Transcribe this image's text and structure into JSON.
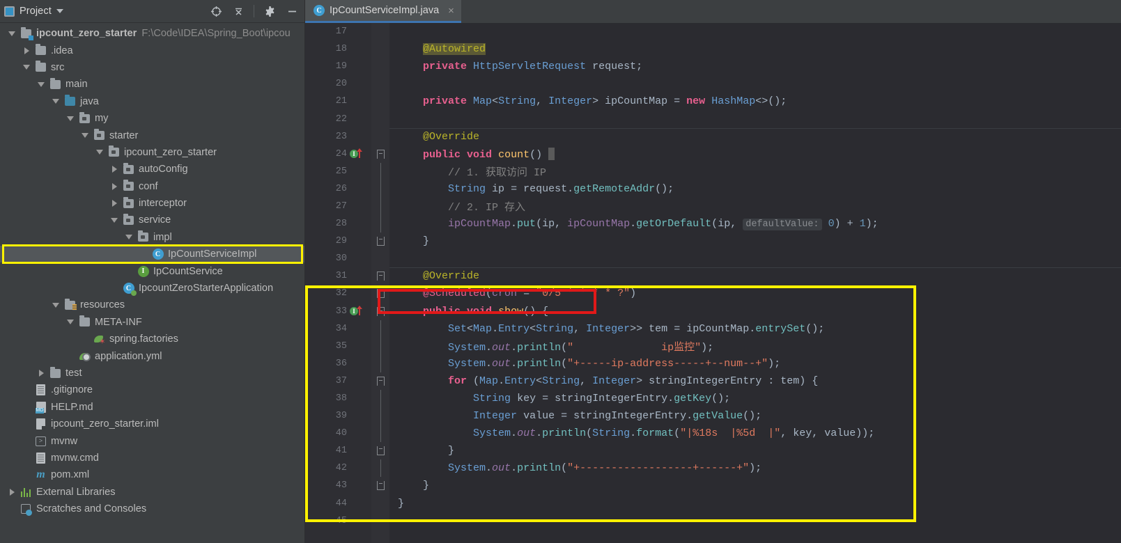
{
  "sidebar": {
    "header": {
      "title": "Project",
      "icons": [
        "project-icon",
        "chevron-down-icon",
        "locate-icon",
        "collapse-all-icon",
        "settings-gear-icon",
        "hide-icon"
      ]
    },
    "tree": [
      {
        "label": "ipcount_zero_starter",
        "path": "F:\\Code\\IDEA\\Spring_Boot\\ipcou",
        "depth": 0,
        "twisty": "down",
        "icon": "module-folder-icon",
        "bold": true
      },
      {
        "label": ".idea",
        "depth": 1,
        "twisty": "right",
        "icon": "folder-icon"
      },
      {
        "label": "src",
        "depth": 1,
        "twisty": "down",
        "icon": "folder-icon"
      },
      {
        "label": "main",
        "depth": 2,
        "twisty": "down",
        "icon": "folder-icon"
      },
      {
        "label": "java",
        "depth": 3,
        "twisty": "down",
        "icon": "source-folder-icon"
      },
      {
        "label": "my",
        "depth": 4,
        "twisty": "down",
        "icon": "package-icon"
      },
      {
        "label": "starter",
        "depth": 5,
        "twisty": "down",
        "icon": "package-icon"
      },
      {
        "label": "ipcount_zero_starter",
        "depth": 6,
        "twisty": "down",
        "icon": "package-icon"
      },
      {
        "label": "autoConfig",
        "depth": 7,
        "twisty": "right",
        "icon": "package-icon"
      },
      {
        "label": "conf",
        "depth": 7,
        "twisty": "right",
        "icon": "package-icon"
      },
      {
        "label": "interceptor",
        "depth": 7,
        "twisty": "right",
        "icon": "package-icon"
      },
      {
        "label": "service",
        "depth": 7,
        "twisty": "down",
        "icon": "package-icon"
      },
      {
        "label": "impl",
        "depth": 8,
        "twisty": "down",
        "icon": "package-icon"
      },
      {
        "label": "IpCountServiceImpl",
        "depth": 9,
        "twisty": "none",
        "icon": "java-class-icon",
        "selected": true
      },
      {
        "label": "IpCountService",
        "depth": 8,
        "twisty": "none",
        "icon": "java-interface-icon"
      },
      {
        "label": "IpcountZeroStarterApplication",
        "depth": 7,
        "twisty": "none",
        "icon": "spring-boot-class-icon"
      },
      {
        "label": "resources",
        "depth": 3,
        "twisty": "down",
        "icon": "resources-folder-icon"
      },
      {
        "label": "META-INF",
        "depth": 4,
        "twisty": "down",
        "icon": "folder-icon"
      },
      {
        "label": "spring.factories",
        "depth": 5,
        "twisty": "none",
        "icon": "spring-factories-icon"
      },
      {
        "label": "application.yml",
        "depth": 4,
        "twisty": "none",
        "icon": "spring-yaml-icon"
      },
      {
        "label": "test",
        "depth": 2,
        "twisty": "right",
        "icon": "folder-icon"
      },
      {
        "label": ".gitignore",
        "depth": 1,
        "twisty": "none",
        "icon": "text-file-icon"
      },
      {
        "label": "HELP.md",
        "depth": 1,
        "twisty": "none",
        "icon": "markdown-file-icon"
      },
      {
        "label": "ipcount_zero_starter.iml",
        "depth": 1,
        "twisty": "none",
        "icon": "iml-file-icon"
      },
      {
        "label": "mvnw",
        "depth": 1,
        "twisty": "none",
        "icon": "shell-script-icon"
      },
      {
        "label": "mvnw.cmd",
        "depth": 1,
        "twisty": "none",
        "icon": "text-file-icon"
      },
      {
        "label": "pom.xml",
        "depth": 1,
        "twisty": "none",
        "icon": "maven-file-icon"
      },
      {
        "label": "External Libraries",
        "depth": 0,
        "twisty": "right",
        "icon": "libraries-icon"
      },
      {
        "label": "Scratches and Consoles",
        "depth": 0,
        "twisty": "none",
        "icon": "scratches-icon"
      }
    ]
  },
  "editor": {
    "tab": {
      "label": "IpCountServiceImpl.java",
      "icon": "java-class-icon",
      "close": "×"
    },
    "lines": [
      {
        "n": "17",
        "marker": "",
        "fold": "",
        "sep": false
      },
      {
        "n": "18",
        "marker": "",
        "fold": "",
        "text": "    @Autowired"
      },
      {
        "n": "19",
        "marker": "",
        "fold": "",
        "text": "    private HttpServletRequest request;"
      },
      {
        "n": "20",
        "marker": "",
        "fold": "",
        "text": ""
      },
      {
        "n": "21",
        "marker": "",
        "fold": "",
        "text": "    private Map<String, Integer> ipCountMap = new HashMap<>();"
      },
      {
        "n": "22",
        "marker": "",
        "fold": "",
        "text": ""
      },
      {
        "n": "23",
        "marker": "",
        "fold": "",
        "text": "    @Override",
        "sep": true
      },
      {
        "n": "24",
        "marker": "implements",
        "fold": "top",
        "text": "    public void count() {"
      },
      {
        "n": "25",
        "marker": "",
        "fold": "pipe",
        "text": "        // 1. 获取访问 IP"
      },
      {
        "n": "26",
        "marker": "",
        "fold": "pipe",
        "text": "        String ip = request.getRemoteAddr();"
      },
      {
        "n": "27",
        "marker": "",
        "fold": "pipe",
        "text": "        // 2. IP 存入"
      },
      {
        "n": "28",
        "marker": "",
        "fold": "pipe",
        "text": "        ipCountMap.put(ip, ipCountMap.getOrDefault(ip,  defaultValue: 0) + 1);"
      },
      {
        "n": "29",
        "marker": "",
        "fold": "bottom",
        "text": "    }"
      },
      {
        "n": "30",
        "marker": "",
        "fold": "",
        "text": ""
      },
      {
        "n": "31",
        "marker": "",
        "fold": "top",
        "text": "    @Override",
        "sep": true
      },
      {
        "n": "32",
        "marker": "",
        "fold": "bottom",
        "text": "    @Scheduled(cron = \"0/5 * * * * ?\")"
      },
      {
        "n": "33",
        "marker": "implements",
        "fold": "top",
        "text": "    public void show() {"
      },
      {
        "n": "34",
        "marker": "",
        "fold": "pipe",
        "text": "        Set<Map.Entry<String, Integer>> tem = ipCountMap.entrySet();"
      },
      {
        "n": "35",
        "marker": "",
        "fold": "pipe",
        "text": "        System.out.println(\"              ip监控\");"
      },
      {
        "n": "36",
        "marker": "",
        "fold": "pipe",
        "text": "        System.out.println(\"+-----ip-address-----+--num--+\");"
      },
      {
        "n": "37",
        "marker": "",
        "fold": "top",
        "text": "        for (Map.Entry<String, Integer> stringIntegerEntry : tem) {"
      },
      {
        "n": "38",
        "marker": "",
        "fold": "pipe",
        "text": "            String key = stringIntegerEntry.getKey();"
      },
      {
        "n": "39",
        "marker": "",
        "fold": "pipe",
        "text": "            Integer value = stringIntegerEntry.getValue();"
      },
      {
        "n": "40",
        "marker": "",
        "fold": "pipe",
        "text": "            System.out.println(String.format(\"|%18s  |%5d  |\", key, value));"
      },
      {
        "n": "41",
        "marker": "",
        "fold": "bottom",
        "text": "        }"
      },
      {
        "n": "42",
        "marker": "",
        "fold": "pipe",
        "text": "        System.out.println(\"+------------------+------+\");"
      },
      {
        "n": "43",
        "marker": "",
        "fold": "bottom",
        "text": "    }"
      },
      {
        "n": "44",
        "marker": "",
        "fold": "",
        "text": "}"
      },
      {
        "n": "45",
        "marker": "",
        "fold": "",
        "text": ""
      }
    ],
    "inlay_hint": "defaultValue:"
  },
  "annotations": {
    "sidebar_highlight_color": "#fff200",
    "code_highlight_color": "#fff200",
    "scheduled_box_color": "#e11919"
  }
}
